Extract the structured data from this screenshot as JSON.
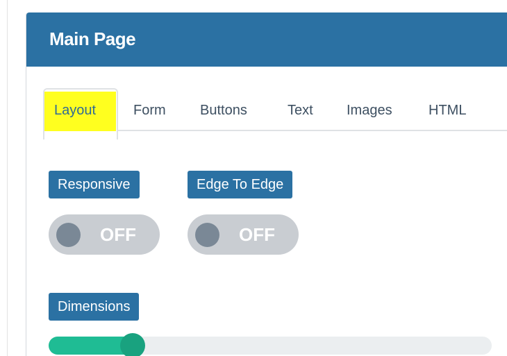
{
  "panel": {
    "title": "Main Page"
  },
  "tabs": [
    {
      "label": "Layout",
      "active": true
    },
    {
      "label": "Form",
      "active": false
    },
    {
      "label": "Buttons",
      "active": false
    },
    {
      "label": "Text",
      "active": false
    },
    {
      "label": "Images",
      "active": false
    },
    {
      "label": "HTML",
      "active": false
    }
  ],
  "toggles": [
    {
      "label": "Responsive",
      "state": "OFF"
    },
    {
      "label": "Edge To Edge",
      "state": "OFF"
    }
  ],
  "dimensions": {
    "label": "Dimensions",
    "value_fraction": 0.19
  },
  "colors": {
    "header": "#2b71a3",
    "label_badge": "#2b71a3",
    "tab_highlight": "#ffff1f",
    "toggle_off": "#c9cdd2",
    "slider_fill": "#1fbc94"
  }
}
